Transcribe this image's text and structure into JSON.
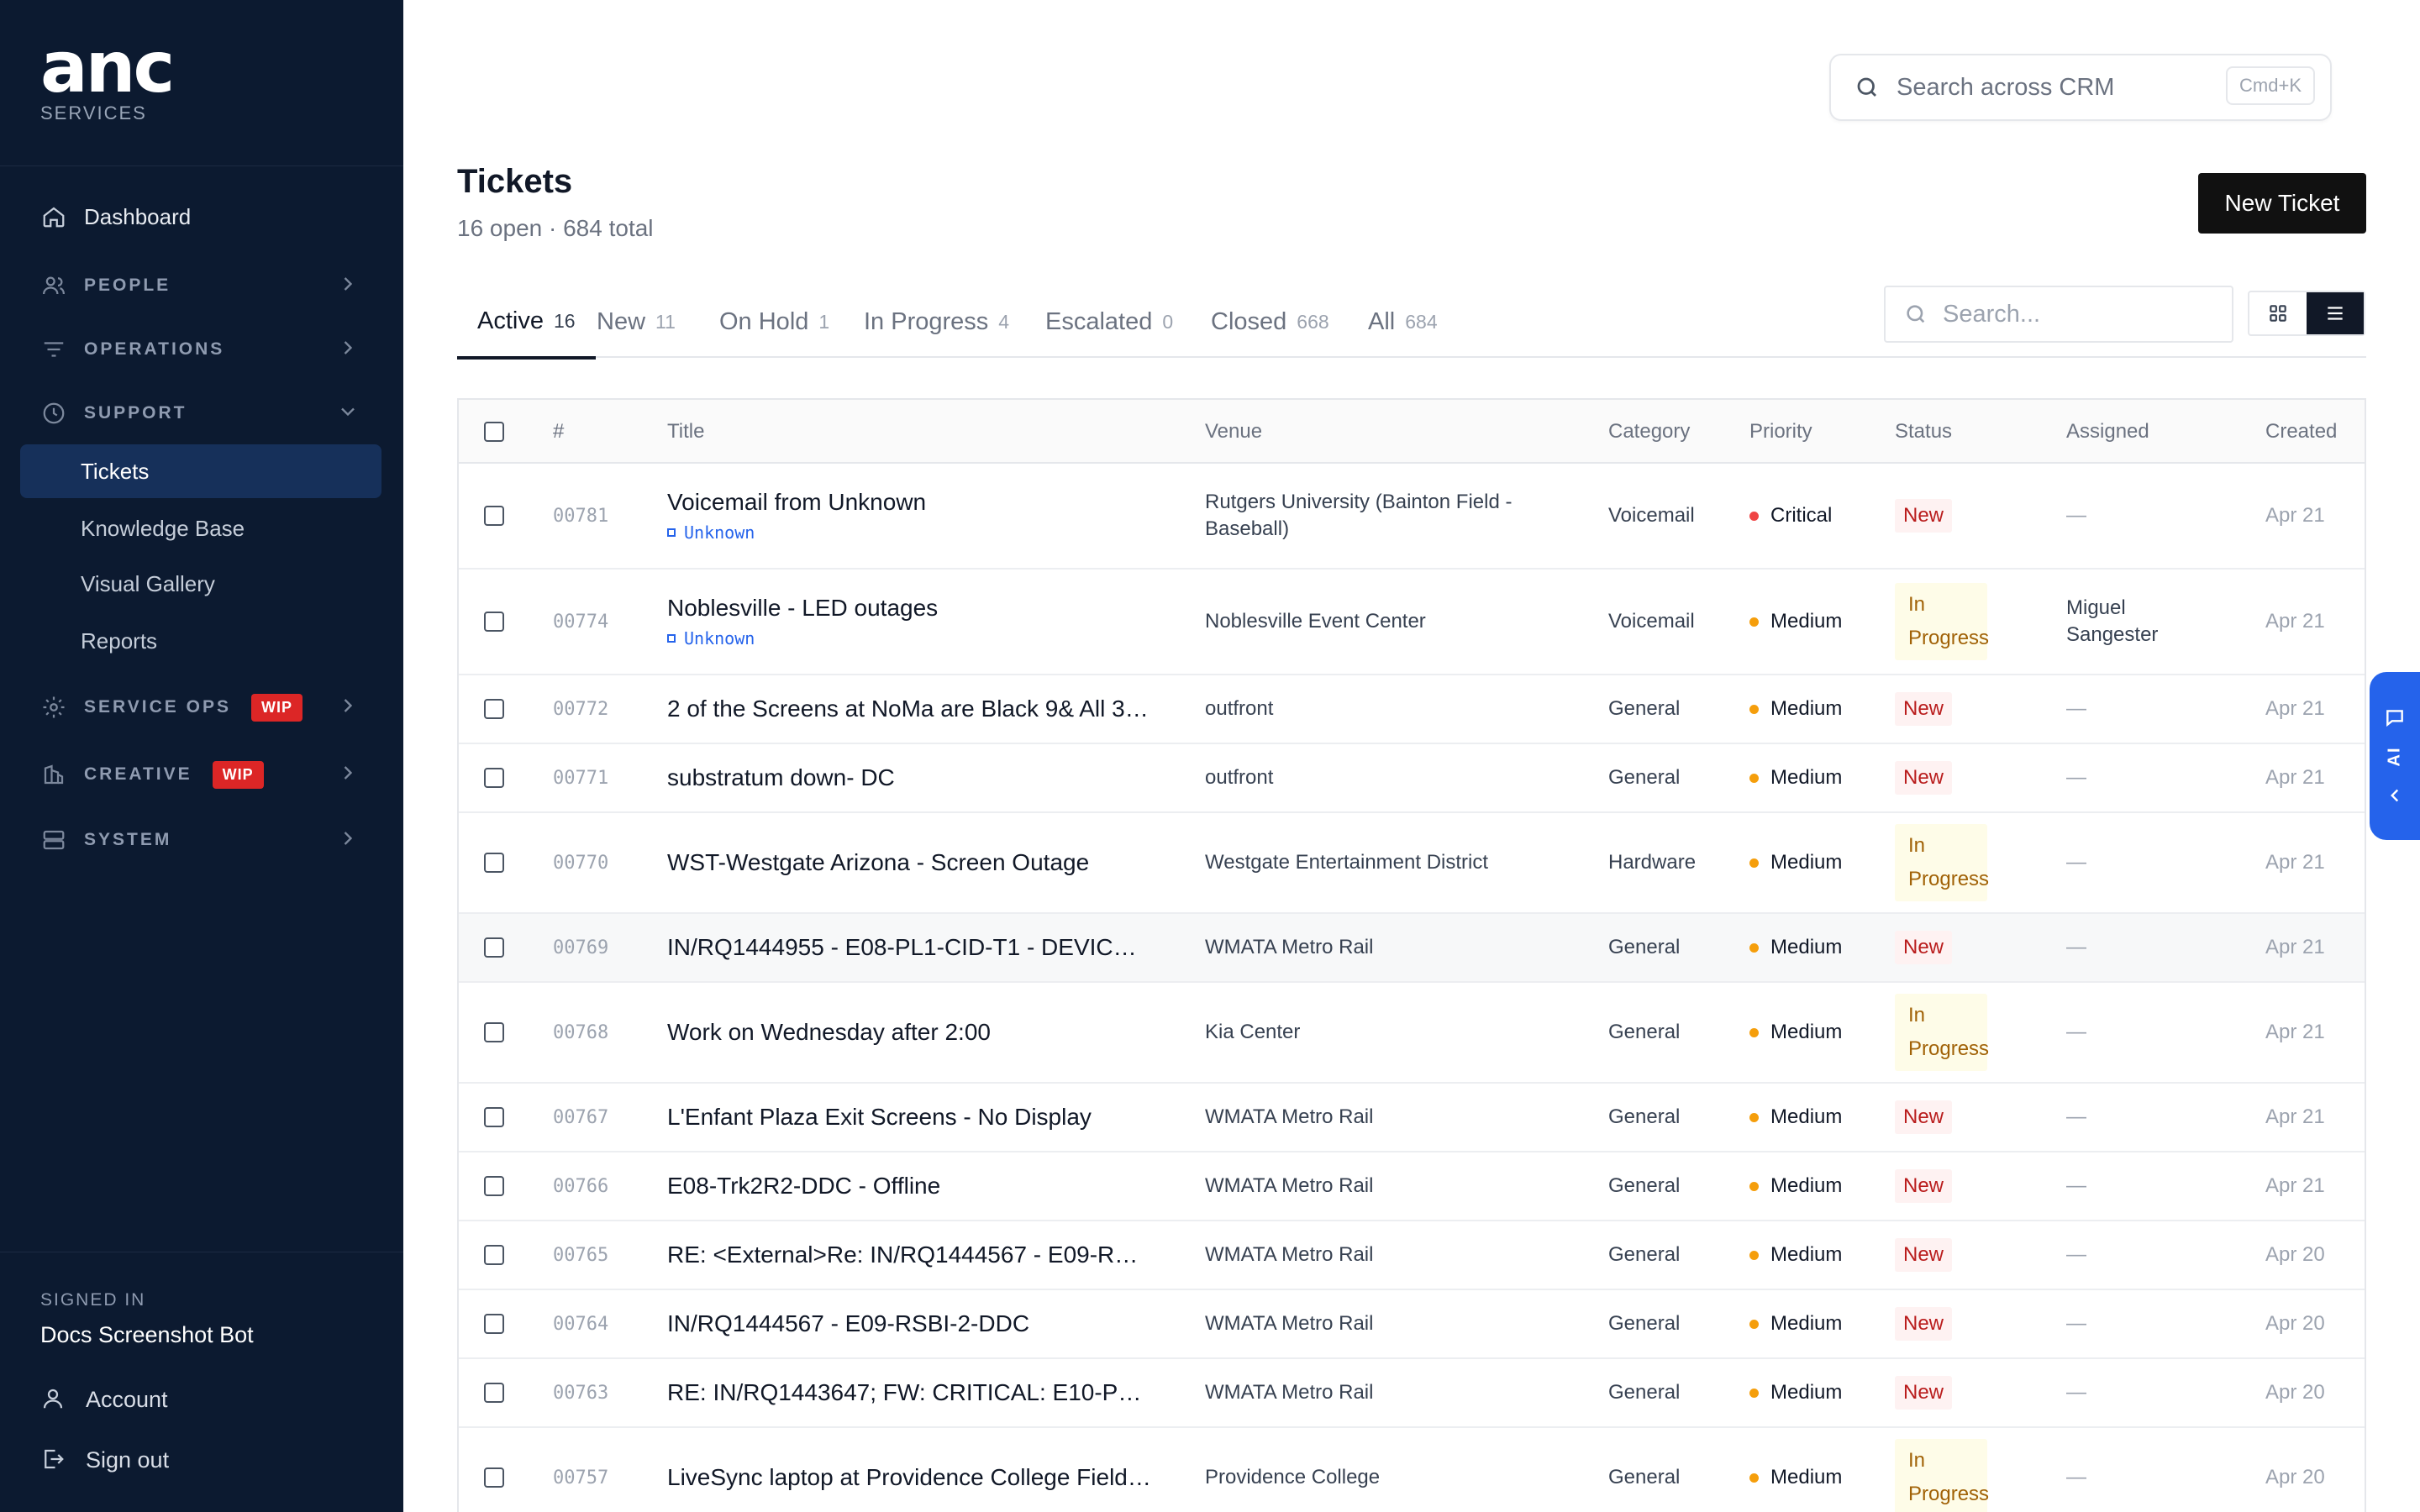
{
  "brand": {
    "logo": "anc",
    "sub": "SERVICES"
  },
  "sidebar": {
    "dashboard": "Dashboard",
    "sections": {
      "people": "PEOPLE",
      "operations": "OPERATIONS",
      "support": "SUPPORT",
      "service_ops": "SERVICE OPS",
      "creative": "CREATIVE",
      "system": "SYSTEM"
    },
    "wip_badge": "WIP",
    "support_items": [
      "Tickets",
      "Knowledge Base",
      "Visual Gallery",
      "Reports"
    ],
    "signed_in_label": "SIGNED IN",
    "user": "Docs Screenshot Bot",
    "account": "Account",
    "sign_out": "Sign out"
  },
  "header": {
    "search_placeholder": "Search across CRM",
    "shortcut": "Cmd+K",
    "title": "Tickets",
    "subtitle": "16 open · 684 total",
    "new_button": "New Ticket"
  },
  "tabs": [
    {
      "label": "Active",
      "count": "16"
    },
    {
      "label": "New",
      "count": "11"
    },
    {
      "label": "On Hold",
      "count": "1"
    },
    {
      "label": "In Progress",
      "count": "4"
    },
    {
      "label": "Escalated",
      "count": "0"
    },
    {
      "label": "Closed",
      "count": "668"
    },
    {
      "label": "All",
      "count": "684"
    }
  ],
  "table_search_placeholder": "Search...",
  "columns": [
    "#",
    "Title",
    "Venue",
    "Category",
    "Priority",
    "Status",
    "Assigned",
    "Created"
  ],
  "rows": [
    {
      "id": "00781",
      "title": "Voicemail from Unknown",
      "sub": "Unknown",
      "venue": "Rutgers University (Bainton Field - Baseball)",
      "category": "Voicemail",
      "priority": "Critical",
      "status": "New",
      "assigned": "—",
      "created": "Apr 21"
    },
    {
      "id": "00774",
      "title": "Noblesville - LED outages",
      "sub": "Unknown",
      "venue": "Noblesville Event Center",
      "category": "Voicemail",
      "priority": "Medium",
      "status": "In Progress",
      "assigned": "Miguel Sangester",
      "created": "Apr 21"
    },
    {
      "id": "00772",
      "title": "2 of the Screens at NoMa are Black 9& All 3…",
      "sub": "",
      "venue": "outfront",
      "category": "General",
      "priority": "Medium",
      "status": "New",
      "assigned": "—",
      "created": "Apr 21"
    },
    {
      "id": "00771",
      "title": "substratum down- DC",
      "sub": "",
      "venue": "outfront",
      "category": "General",
      "priority": "Medium",
      "status": "New",
      "assigned": "—",
      "created": "Apr 21"
    },
    {
      "id": "00770",
      "title": "WST-Westgate Arizona - Screen Outage",
      "sub": "",
      "venue": "Westgate Entertainment District",
      "category": "Hardware",
      "priority": "Medium",
      "status": "In Progress",
      "assigned": "—",
      "created": "Apr 21"
    },
    {
      "id": "00769",
      "title": "IN/RQ1444955 - E08-PL1-CID-T1 - DEVIC…",
      "sub": "",
      "venue": "WMATA Metro Rail",
      "category": "General",
      "priority": "Medium",
      "status": "New",
      "assigned": "—",
      "created": "Apr 21"
    },
    {
      "id": "00768",
      "title": "Work on Wednesday after 2:00",
      "sub": "",
      "venue": "Kia Center",
      "category": "General",
      "priority": "Medium",
      "status": "In Progress",
      "assigned": "—",
      "created": "Apr 21"
    },
    {
      "id": "00767",
      "title": "L'Enfant Plaza Exit Screens - No Display",
      "sub": "",
      "venue": "WMATA Metro Rail",
      "category": "General",
      "priority": "Medium",
      "status": "New",
      "assigned": "—",
      "created": "Apr 21"
    },
    {
      "id": "00766",
      "title": "E08-Trk2R2-DDC - Offline",
      "sub": "",
      "venue": "WMATA Metro Rail",
      "category": "General",
      "priority": "Medium",
      "status": "New",
      "assigned": "—",
      "created": "Apr 21"
    },
    {
      "id": "00765",
      "title": "RE: <External>Re: IN/RQ1444567 - E09-R…",
      "sub": "",
      "venue": "WMATA Metro Rail",
      "category": "General",
      "priority": "Medium",
      "status": "New",
      "assigned": "—",
      "created": "Apr 20"
    },
    {
      "id": "00764",
      "title": "IN/RQ1444567 - E09-RSBI-2-DDC",
      "sub": "",
      "venue": "WMATA Metro Rail",
      "category": "General",
      "priority": "Medium",
      "status": "New",
      "assigned": "—",
      "created": "Apr 20"
    },
    {
      "id": "00763",
      "title": "RE: IN/RQ1443647; FW: CRITICAL: E10-P…",
      "sub": "",
      "venue": "WMATA Metro Rail",
      "category": "General",
      "priority": "Medium",
      "status": "New",
      "assigned": "—",
      "created": "Apr 20"
    },
    {
      "id": "00757",
      "title": "LiveSync laptop at Providence College Field…",
      "sub": "",
      "venue": "Providence College",
      "category": "General",
      "priority": "Medium",
      "status": "In Progress",
      "assigned": "—",
      "created": "Apr 20"
    }
  ],
  "ai_tab": "AI",
  "colors": {
    "critical": "#ef4444",
    "medium": "#f59e0b",
    "sidebar": "#0c1a30",
    "accent": "#2563eb"
  }
}
